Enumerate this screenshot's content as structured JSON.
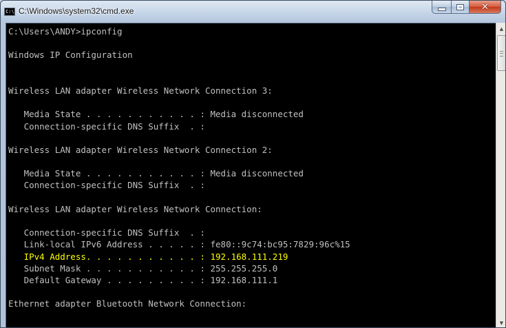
{
  "window": {
    "title": "C:\\Windows\\system32\\cmd.exe",
    "icon": "cmd-icon",
    "buttons": {
      "minimize": "minimize-icon",
      "maximize": "maximize-icon",
      "close": "close-icon"
    }
  },
  "console": {
    "text_color": "#c0c0c0",
    "highlight_color": "#ffff00",
    "background": "#000000",
    "lines": [
      "C:\\Users\\ANDY>ipconfig",
      "",
      "Windows IP Configuration",
      "",
      "",
      "Wireless LAN adapter Wireless Network Connection 3:",
      "",
      "   Media State . . . . . . . . . . . : Media disconnected",
      "   Connection-specific DNS Suffix  . :",
      "",
      "Wireless LAN adapter Wireless Network Connection 2:",
      "",
      "   Media State . . . . . . . . . . . : Media disconnected",
      "   Connection-specific DNS Suffix  . :",
      "",
      "Wireless LAN adapter Wireless Network Connection:",
      "",
      "   Connection-specific DNS Suffix  . :",
      "   Link-local IPv6 Address . . . . . : fe80::9c74:bc95:7829:96c%15",
      "   IPv4 Address. . . . . . . . . . . : 192.168.111.219",
      "   Subnet Mask . . . . . . . . . . . : 255.255.255.0",
      "   Default Gateway . . . . . . . . . : 192.168.111.1",
      "",
      "Ethernet adapter Bluetooth Network Connection:",
      ""
    ],
    "highlighted_line_index": 19
  }
}
